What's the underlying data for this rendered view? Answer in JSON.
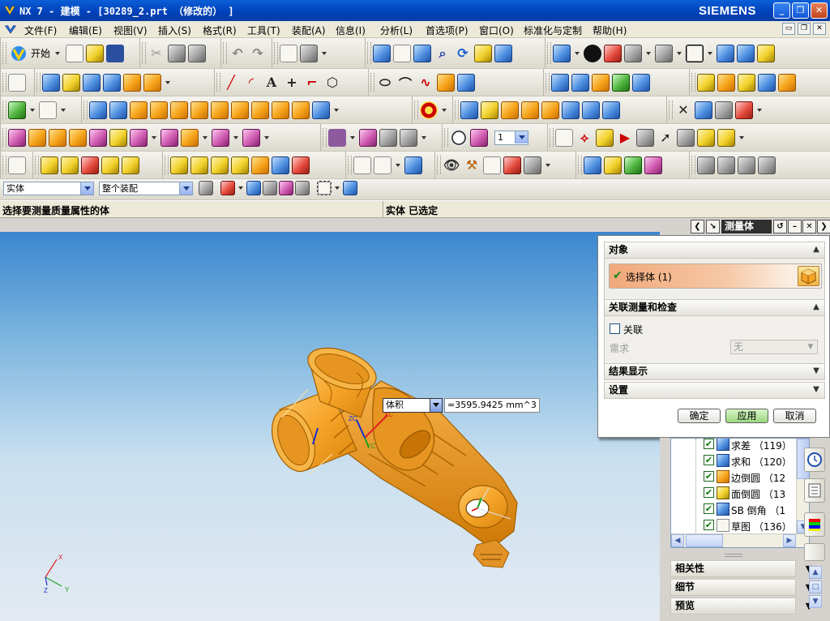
{
  "window": {
    "title": "NX 7 - 建模 - [30289_2.prt （修改的） ]",
    "brand": "SIEMENS",
    "controls": [
      "_",
      "❐",
      "✕"
    ]
  },
  "menubar": {
    "items": [
      "文件(F)",
      "编辑(E)",
      "视图(V)",
      "插入(S)",
      "格式(R)",
      "工具(T)",
      "装配(A)",
      "信息(I)",
      "分析(L)",
      "首选项(P)",
      "窗口(O)",
      "标准化与定制",
      "帮助(H)"
    ],
    "doc_controls": [
      "▭",
      "❐",
      "✕"
    ]
  },
  "toolbar": {
    "start_label": "开始",
    "view_combo_value": "1"
  },
  "selection_bar": {
    "type_filter": "实体",
    "scope_filter": "整个装配"
  },
  "cue_line": {
    "prompt": "选择要测量质量属性的体",
    "status": "实体 已选定"
  },
  "dialog": {
    "title": "测量体",
    "sections": {
      "object": "对象",
      "assoc": "关联测量和检查",
      "results": "结果显示",
      "settings": "设置"
    },
    "select_body_label": "选择体 (1)",
    "assoc_checkbox_label": "关联",
    "requirement_label": "需求",
    "requirement_value": "无",
    "buttons": {
      "ok": "确定",
      "apply": "应用",
      "cancel": "取消"
    }
  },
  "viewport": {
    "measure_type": "体积",
    "measure_value": "=3595.9425 mm^3",
    "wcs_labels": {
      "zc": "ZC",
      "yc": "YC",
      "xc": "XC"
    },
    "abs_axes": {
      "x": "X",
      "y": "Y",
      "z": "Z"
    }
  },
  "part_navigator": {
    "rows": [
      {
        "label": "求差 （119）",
        "icon": "subtract-icon"
      },
      {
        "label": "求和 （120）",
        "icon": "unite-icon"
      },
      {
        "label": "边倒圆 （12",
        "icon": "edge-blend-icon"
      },
      {
        "label": "面倒圆 （13",
        "icon": "face-blend-icon"
      },
      {
        "label": "SB 倒角 （1",
        "icon": "chamfer-icon"
      },
      {
        "label": "草图 （136）",
        "icon": "sketch-icon"
      }
    ],
    "panels": {
      "dependencies": "相关性",
      "details": "细节",
      "preview": "预览"
    }
  },
  "colors": {
    "title_blue": "#0a4fc8",
    "model_orange": "#f5a428",
    "select_highlight": "#f1a87a",
    "apply_green": "#9bd67f"
  }
}
